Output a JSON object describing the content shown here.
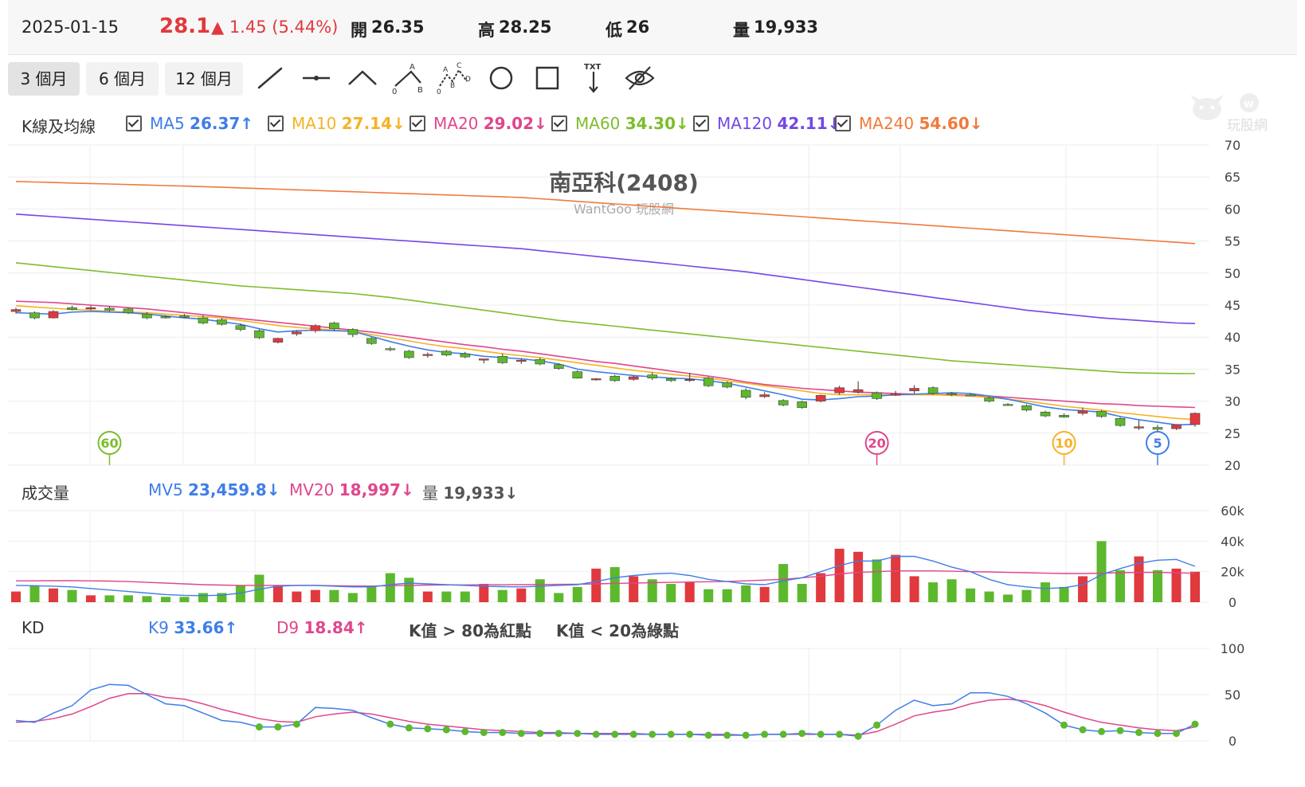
{
  "quote": {
    "date": "2025-01-15",
    "price": "28.1",
    "change": "▲ 1.45 (5.44%)",
    "open_label": "開",
    "open": "26.35",
    "high_label": "高",
    "high": "28.25",
    "low_label": "低",
    "low": "26",
    "vol_label": "量",
    "vol": "19,933"
  },
  "toolbar": {
    "periods": [
      "3 個月",
      "6 個月",
      "12 個月"
    ],
    "active_period": "3 個月",
    "tools": [
      "line-tool-icon",
      "horizontal-line-tool-icon",
      "polyline-tool-icon",
      "abc-pattern-tool-icon",
      "abcd-pattern-tool-icon",
      "circle-tool-icon",
      "rectangle-tool-icon",
      "text-tool-icon",
      "hide-drawings-icon"
    ],
    "tool_labels": {
      "a": "A",
      "b": "B",
      "c": "C",
      "d": "D",
      "zero": "0",
      "txt": "TXT"
    }
  },
  "colors": {
    "ma5": "#3f7ee8",
    "ma10": "#f5b223",
    "ma20": "#e0468c",
    "ma60": "#7dbd2c",
    "ma120": "#7447e6",
    "ma240": "#f07a3a",
    "up": "#e0393e",
    "down": "#5cb82d",
    "flat": "#aaaaaa"
  },
  "kline_panel": {
    "label": "K線及均線",
    "mas": [
      {
        "name": "MA5",
        "value": "26.37",
        "arrow": "↑",
        "color": "#3f7ee8"
      },
      {
        "name": "MA10",
        "value": "27.14",
        "arrow": "↓",
        "color": "#f5b223"
      },
      {
        "name": "MA20",
        "value": "29.02",
        "arrow": "↓",
        "color": "#e0468c"
      },
      {
        "name": "MA60",
        "value": "34.30",
        "arrow": "↓",
        "color": "#7dbd2c"
      },
      {
        "name": "MA120",
        "value": "42.11",
        "arrow": "↓",
        "color": "#7447e6"
      },
      {
        "name": "MA240",
        "value": "54.60",
        "arrow": "↓",
        "color": "#f07a3a"
      }
    ],
    "title": "南亞科(2408)",
    "subtitle": "WantGoo 玩股網"
  },
  "volume_panel": {
    "label": "成交量",
    "items": [
      {
        "name": "MV5",
        "value": "23,459.8",
        "arrow": "↓",
        "color": "#3f7ee8"
      },
      {
        "name": "MV20",
        "value": "18,997",
        "arrow": "↓",
        "color": "#e0468c"
      },
      {
        "name": "量",
        "value": "19,933",
        "arrow": "↓",
        "color": "#555555"
      }
    ]
  },
  "kd_panel": {
    "label": "KD",
    "items": [
      {
        "name": "K9",
        "value": "33.66",
        "arrow": "↑",
        "color": "#3f7ee8"
      },
      {
        "name": "D9",
        "value": "18.84",
        "arrow": "↑",
        "color": "#e0468c"
      }
    ],
    "note1": "K值 > 80為紅點",
    "note2": "K值 < 20為綠點"
  },
  "watermark_text": "玩股網",
  "chart_data": [
    {
      "type": "candlestick",
      "title": "南亞科(2408)",
      "subtitle": "WantGoo 玩股網",
      "yticks": [
        "70",
        "65",
        "60",
        "55",
        "50",
        "45",
        "40",
        "35",
        "30",
        "25",
        "20"
      ],
      "ylim": [
        20,
        70
      ],
      "ohlc": [
        [
          44.0,
          44.6,
          43.7,
          44.3
        ],
        [
          43.8,
          44.0,
          42.8,
          43.0
        ],
        [
          43.0,
          44.2,
          42.9,
          44.0
        ],
        [
          44.6,
          44.9,
          44.2,
          44.3
        ],
        [
          44.4,
          44.9,
          44.2,
          44.6
        ],
        [
          44.5,
          44.8,
          44.0,
          44.2
        ],
        [
          44.4,
          44.6,
          43.6,
          43.8
        ],
        [
          43.6,
          43.9,
          42.8,
          43.0
        ],
        [
          43.2,
          43.4,
          42.9,
          43.0
        ],
        [
          43.3,
          43.6,
          43.0,
          43.2
        ],
        [
          43.0,
          43.4,
          42.0,
          42.2
        ],
        [
          42.7,
          43.0,
          41.8,
          42.0
        ],
        [
          41.8,
          42.1,
          40.9,
          41.2
        ],
        [
          41.0,
          41.2,
          39.7,
          39.9
        ],
        [
          39.2,
          39.9,
          39.0,
          39.8
        ],
        [
          40.5,
          41.0,
          40.2,
          40.8
        ],
        [
          41.0,
          42.0,
          40.7,
          41.8
        ],
        [
          42.2,
          42.4,
          41.0,
          41.3
        ],
        [
          41.2,
          41.4,
          40.0,
          40.4
        ],
        [
          39.8,
          40.0,
          38.8,
          39.0
        ],
        [
          38.2,
          38.5,
          37.8,
          38.1
        ],
        [
          37.8,
          38.0,
          36.6,
          36.8
        ],
        [
          37.2,
          37.6,
          36.8,
          37.3
        ],
        [
          37.8,
          38.0,
          37.0,
          37.2
        ],
        [
          37.4,
          37.7,
          36.7,
          36.9
        ],
        [
          36.4,
          36.6,
          35.9,
          36.6
        ],
        [
          37.0,
          37.4,
          35.8,
          36.0
        ],
        [
          36.3,
          36.7,
          35.8,
          36.4
        ],
        [
          36.5,
          36.8,
          35.6,
          35.8
        ],
        [
          35.7,
          35.9,
          34.9,
          35.1
        ],
        [
          34.6,
          34.8,
          33.5,
          33.6
        ],
        [
          33.4,
          33.6,
          33.2,
          33.5
        ],
        [
          33.9,
          34.1,
          33.0,
          33.2
        ],
        [
          33.4,
          34.0,
          33.2,
          33.8
        ],
        [
          34.1,
          34.5,
          33.3,
          33.6
        ],
        [
          33.5,
          33.7,
          33.0,
          33.2
        ],
        [
          33.3,
          34.4,
          33.0,
          33.4
        ],
        [
          33.6,
          33.8,
          32.2,
          32.4
        ],
        [
          32.9,
          33.1,
          32.0,
          32.2
        ],
        [
          31.7,
          32.0,
          30.3,
          30.6
        ],
        [
          30.7,
          31.4,
          30.5,
          31.0
        ],
        [
          30.1,
          30.3,
          29.2,
          29.4
        ],
        [
          29.9,
          30.1,
          28.8,
          29.0
        ],
        [
          30.0,
          31.0,
          29.8,
          30.9
        ],
        [
          31.3,
          32.4,
          31.0,
          32.1
        ],
        [
          31.4,
          33.1,
          31.2,
          31.8
        ],
        [
          31.3,
          31.5,
          30.2,
          30.4
        ],
        [
          31.0,
          31.6,
          30.8,
          31.1
        ],
        [
          31.6,
          32.5,
          31.2,
          32.0
        ],
        [
          32.1,
          32.3,
          31.0,
          31.2
        ],
        [
          31.2,
          31.4,
          30.8,
          31.0
        ],
        [
          31.0,
          31.2,
          30.8,
          30.9
        ],
        [
          30.5,
          30.7,
          29.8,
          30.0
        ],
        [
          29.5,
          29.7,
          29.3,
          29.4
        ],
        [
          29.3,
          29.5,
          28.4,
          28.6
        ],
        [
          28.3,
          28.5,
          27.5,
          27.7
        ],
        [
          27.8,
          28.1,
          27.4,
          27.5
        ],
        [
          28.1,
          29.0,
          27.8,
          28.5
        ],
        [
          28.4,
          28.6,
          27.4,
          27.6
        ],
        [
          27.3,
          27.5,
          26.0,
          26.2
        ],
        [
          25.8,
          27.0,
          25.5,
          26.0
        ],
        [
          25.9,
          26.3,
          25.0,
          25.6
        ],
        [
          25.7,
          26.4,
          25.5,
          26.3
        ],
        [
          26.35,
          28.25,
          26.0,
          28.1
        ]
      ],
      "ma5": [
        43.8,
        43.7,
        43.6,
        43.9,
        44.0,
        43.9,
        43.8,
        43.6,
        43.3,
        43.0,
        42.8,
        42.4,
        42.0,
        41.3,
        40.8,
        41.0,
        41.1,
        41.0,
        40.9,
        40.1,
        39.3,
        38.6,
        38.0,
        37.6,
        37.4,
        37.0,
        36.8,
        36.6,
        36.3,
        35.8,
        35.0,
        34.6,
        34.3,
        34.0,
        33.8,
        33.6,
        33.5,
        33.2,
        32.8,
        32.2,
        31.6,
        31.0,
        30.3,
        30.2,
        30.4,
        30.7,
        30.8,
        31.0,
        31.1,
        31.2,
        31.3,
        31.2,
        30.8,
        30.3,
        29.7,
        29.1,
        28.7,
        28.5,
        28.3,
        27.6,
        27.1,
        26.7,
        26.3,
        26.37
      ],
      "ma10": [
        44.9,
        44.7,
        44.5,
        44.3,
        44.2,
        44.0,
        43.9,
        43.8,
        43.6,
        43.4,
        43.2,
        43.0,
        42.6,
        42.2,
        41.8,
        41.5,
        41.3,
        41.1,
        40.9,
        40.4,
        39.9,
        39.4,
        38.9,
        38.5,
        38.2,
        37.8,
        37.4,
        37.1,
        36.8,
        36.4,
        36.0,
        35.6,
        35.2,
        34.8,
        34.5,
        34.2,
        33.9,
        33.6,
        33.2,
        32.8,
        32.4,
        32.0,
        31.6,
        31.2,
        31.0,
        31.0,
        31.0,
        31.0,
        31.0,
        31.0,
        30.9,
        30.8,
        30.6,
        30.3,
        30.0,
        29.6,
        29.2,
        28.9,
        28.6,
        28.2,
        27.9,
        27.6,
        27.3,
        27.14
      ],
      "ma20": [
        45.6,
        45.5,
        45.4,
        45.2,
        45.0,
        44.8,
        44.6,
        44.4,
        44.1,
        43.8,
        43.5,
        43.2,
        42.9,
        42.6,
        42.3,
        42.0,
        41.7,
        41.4,
        41.1,
        40.8,
        40.4,
        40.0,
        39.6,
        39.2,
        38.8,
        38.5,
        38.1,
        37.8,
        37.4,
        37.0,
        36.6,
        36.2,
        35.9,
        35.5,
        35.1,
        34.7,
        34.3,
        33.9,
        33.5,
        33.0,
        32.6,
        32.3,
        32.0,
        31.8,
        31.6,
        31.4,
        31.3,
        31.2,
        31.1,
        31.0,
        31.0,
        30.9,
        30.8,
        30.6,
        30.4,
        30.2,
        30.0,
        29.8,
        29.6,
        29.5,
        29.3,
        29.2,
        29.1,
        29.02
      ],
      "ma60": [
        51.6,
        51.3,
        51.0,
        50.7,
        50.4,
        50.1,
        49.8,
        49.5,
        49.2,
        48.9,
        48.6,
        48.3,
        48.0,
        47.8,
        47.6,
        47.4,
        47.2,
        47.0,
        46.8,
        46.5,
        46.2,
        45.8,
        45.4,
        45.0,
        44.6,
        44.2,
        43.8,
        43.4,
        43.0,
        42.6,
        42.3,
        42.0,
        41.7,
        41.4,
        41.1,
        40.8,
        40.5,
        40.2,
        39.9,
        39.6,
        39.3,
        39.0,
        38.7,
        38.4,
        38.1,
        37.8,
        37.5,
        37.2,
        36.9,
        36.6,
        36.3,
        36.1,
        35.9,
        35.7,
        35.5,
        35.3,
        35.1,
        34.9,
        34.7,
        34.5,
        34.4,
        34.35,
        34.32,
        34.3
      ],
      "ma120": [
        59.2,
        59.0,
        58.8,
        58.6,
        58.4,
        58.2,
        58.0,
        57.8,
        57.6,
        57.4,
        57.2,
        57.0,
        56.8,
        56.6,
        56.4,
        56.2,
        56.0,
        55.8,
        55.6,
        55.4,
        55.2,
        55.0,
        54.8,
        54.6,
        54.4,
        54.2,
        54.0,
        53.8,
        53.5,
        53.2,
        52.9,
        52.6,
        52.3,
        52.0,
        51.7,
        51.4,
        51.1,
        50.8,
        50.5,
        50.2,
        49.8,
        49.4,
        49.0,
        48.6,
        48.2,
        47.8,
        47.4,
        47.0,
        46.6,
        46.2,
        45.8,
        45.4,
        45.0,
        44.6,
        44.2,
        43.9,
        43.6,
        43.3,
        43.0,
        42.8,
        42.6,
        42.4,
        42.2,
        42.11
      ],
      "ma240": [
        64.3,
        64.22,
        64.14,
        64.06,
        63.98,
        63.9,
        63.82,
        63.74,
        63.66,
        63.58,
        63.5,
        63.4,
        63.3,
        63.2,
        63.1,
        63.0,
        62.9,
        62.8,
        62.7,
        62.6,
        62.5,
        62.4,
        62.3,
        62.2,
        62.1,
        62.0,
        61.9,
        61.8,
        61.6,
        61.4,
        61.2,
        61.0,
        60.8,
        60.6,
        60.4,
        60.2,
        60.0,
        59.8,
        59.6,
        59.4,
        59.2,
        59.0,
        58.8,
        58.6,
        58.4,
        58.2,
        58.0,
        57.8,
        57.6,
        57.4,
        57.2,
        57.0,
        56.8,
        56.6,
        56.4,
        56.2,
        56.0,
        55.8,
        55.6,
        55.4,
        55.2,
        55.0,
        54.8,
        54.6
      ],
      "markers": [
        {
          "label": "60",
          "index": 5,
          "color": "#7dbd2c"
        },
        {
          "label": "20",
          "index": 46,
          "color": "#e0468c"
        },
        {
          "label": "10",
          "index": 56,
          "color": "#f5b223"
        },
        {
          "label": "5",
          "index": 61,
          "color": "#3f7ee8"
        }
      ]
    },
    {
      "type": "bar",
      "name": "成交量",
      "yticks": [
        "60k",
        "40k",
        "20k",
        "0"
      ],
      "ylim": [
        0,
        60000
      ],
      "volume": [
        7000,
        11000,
        9000,
        8000,
        4500,
        4500,
        4500,
        4000,
        3500,
        3500,
        6000,
        6000,
        11000,
        18000,
        11000,
        7000,
        8000,
        8000,
        6000,
        10000,
        19000,
        16000,
        7000,
        7000,
        7000,
        12000,
        8000,
        9000,
        15000,
        6000,
        10000,
        22000,
        23000,
        17000,
        15000,
        12000,
        13000,
        8500,
        8500,
        11000,
        10000,
        25000,
        12000,
        19000,
        35000,
        33000,
        28000,
        31000,
        17000,
        13000,
        15000,
        9000,
        7000,
        5000,
        8000,
        13000,
        10000,
        17000,
        40000,
        21000,
        30000,
        21000,
        22000,
        19933
      ],
      "mv5": [
        11000,
        10800,
        10500,
        10000,
        9000,
        8000,
        7000,
        6000,
        5000,
        4500,
        4300,
        4600,
        6000,
        8500,
        10500,
        11000,
        11000,
        10500,
        10000,
        10000,
        11500,
        12500,
        12000,
        11500,
        11000,
        10500,
        10200,
        10000,
        10500,
        11000,
        11500,
        13500,
        16000,
        17500,
        18500,
        19000,
        17500,
        15000,
        13500,
        12000,
        11500,
        14000,
        16000,
        20000,
        24000,
        27000,
        27000,
        30000,
        30000,
        27000,
        23000,
        20000,
        15000,
        11500,
        10000,
        9000,
        9500,
        11500,
        18000,
        22000,
        25500,
        27500,
        28000,
        23459.8
      ],
      "mv20": [
        14000,
        14000,
        14100,
        14100,
        14000,
        13800,
        13500,
        13000,
        12500,
        12000,
        11500,
        11200,
        11000,
        11000,
        11000,
        11000,
        11000,
        10800,
        10600,
        10600,
        10800,
        11000,
        11200,
        11300,
        11300,
        11400,
        11400,
        11500,
        11600,
        11700,
        11800,
        12000,
        12300,
        12600,
        12800,
        13000,
        13200,
        13400,
        13600,
        14000,
        14500,
        15000,
        16000,
        17000,
        18500,
        19500,
        20000,
        20500,
        20500,
        20500,
        20300,
        20000,
        19800,
        19500,
        19300,
        19000,
        18800,
        18800,
        19000,
        19300,
        19500,
        19500,
        19200,
        18997
      ]
    },
    {
      "type": "line",
      "name": "KD",
      "yticks": [
        "100",
        "50",
        "0"
      ],
      "ylim": [
        0,
        100
      ],
      "k": [
        22,
        20,
        30,
        38,
        55,
        61,
        60,
        50,
        40,
        38,
        30,
        22,
        20,
        15,
        15,
        18,
        36,
        35,
        33,
        25,
        18,
        14,
        13,
        12,
        10,
        9,
        9,
        8,
        8,
        8,
        8,
        7,
        7,
        7,
        7,
        7,
        7,
        6,
        6,
        6,
        7,
        7,
        8,
        7,
        7,
        5,
        17,
        33,
        44,
        38,
        40,
        52,
        52,
        48,
        40,
        30,
        17,
        12,
        10,
        11,
        9,
        8,
        8,
        18
      ],
      "d": [
        20,
        21,
        24,
        29,
        37,
        46,
        51,
        51,
        47,
        45,
        40,
        34,
        29,
        24,
        21,
        20,
        26,
        29,
        31,
        29,
        25,
        21,
        18,
        16,
        14,
        12,
        11,
        10,
        9,
        9,
        8,
        8,
        8,
        8,
        7,
        7,
        7,
        7,
        7,
        6,
        7,
        7,
        7,
        7,
        7,
        6,
        10,
        18,
        27,
        31,
        34,
        40,
        44,
        45,
        43,
        38,
        31,
        25,
        20,
        17,
        14,
        12,
        11,
        15
      ],
      "dots_below": 20
    }
  ]
}
